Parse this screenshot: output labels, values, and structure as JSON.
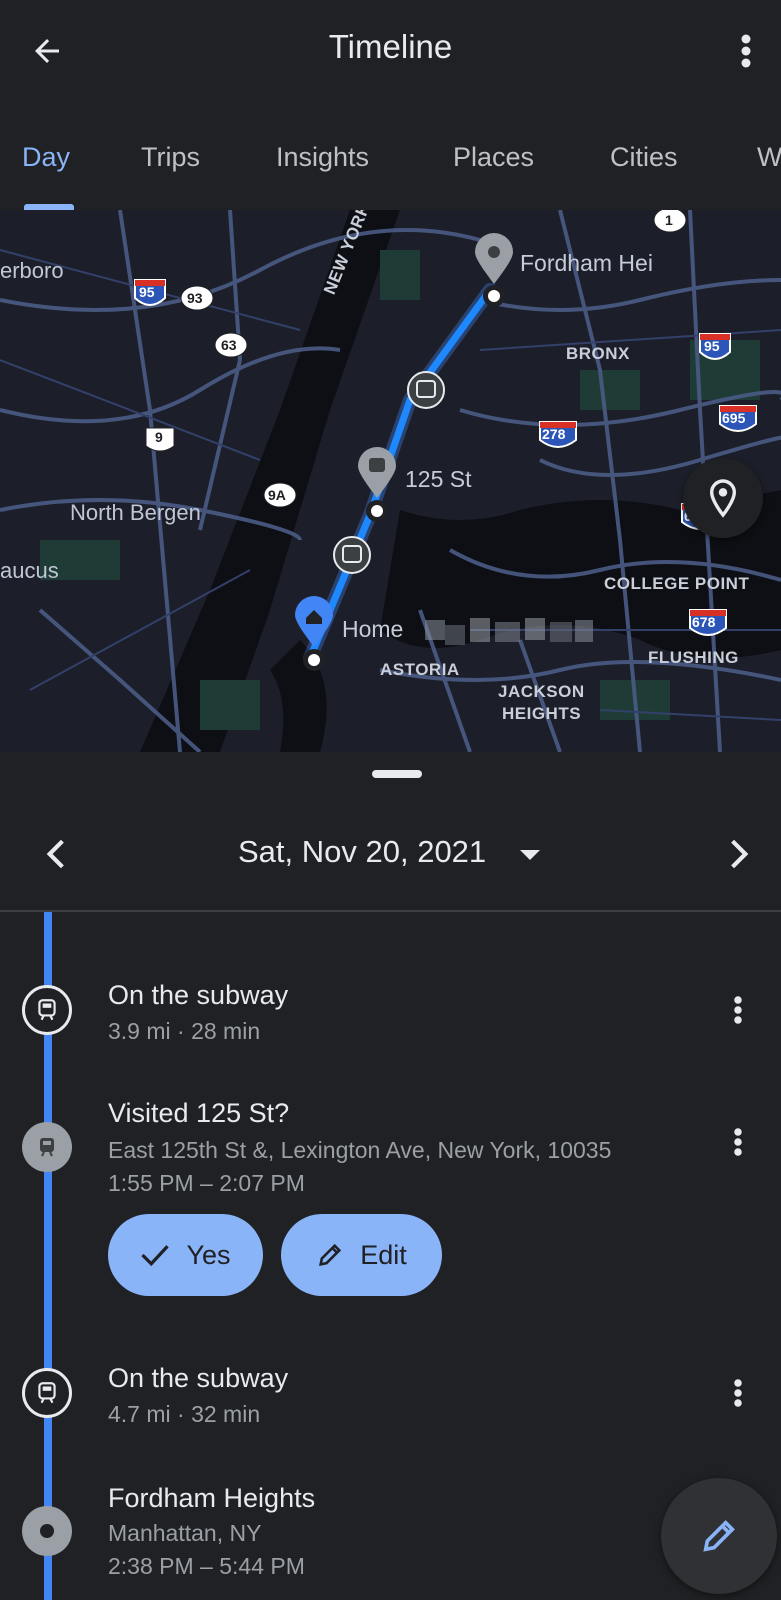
{
  "app": {
    "title": "Timeline"
  },
  "tabs": [
    {
      "label": "Day",
      "active": true
    },
    {
      "label": "Trips"
    },
    {
      "label": "Insights"
    },
    {
      "label": "Places"
    },
    {
      "label": "Cities"
    },
    {
      "label": "W"
    }
  ],
  "map": {
    "labels": {
      "fordham": "Fordham Hei",
      "st125": "125 St",
      "home": "Home",
      "north_bergen": "North Bergen",
      "secaucus": "aucus",
      "teterboro": "erboro",
      "new_york": "NEW YORK",
      "bronx": "BRONX",
      "astoria": "ASTORIA",
      "jackson_heights_1": "JACKSON",
      "jackson_heights_2": "HEIGHTS",
      "college_point": "COLLEGE POINT",
      "flushing": "FLUSHING"
    },
    "shields": {
      "i95_left": "95",
      "r93": "93",
      "r63": "63",
      "r9": "9",
      "r9a": "9A",
      "r1": "1",
      "i95_right": "95",
      "i695": "695",
      "i278": "278",
      "i678a": "678",
      "i678b": "678"
    }
  },
  "date": {
    "label": "Sat, Nov 20, 2021"
  },
  "entries": [
    {
      "title": "On the subway",
      "subtitle": "3.9 mi · 28 min"
    },
    {
      "title": "Visited 125 St?",
      "address": "East 125th St &, Lexington Ave, New York, 10035",
      "time": "1:55 PM – 2:07 PM",
      "yes_label": "Yes",
      "edit_label": "Edit"
    },
    {
      "title": "On the subway",
      "subtitle": "4.7 mi · 32 min"
    },
    {
      "title": "Fordham Heights",
      "address": "Manhattan, NY",
      "time": "2:38 PM – 5:44 PM"
    }
  ],
  "colors": {
    "accent": "#8ab4f8",
    "route": "#1a73e8",
    "timeline": "#4285f4",
    "background": "#202124"
  }
}
